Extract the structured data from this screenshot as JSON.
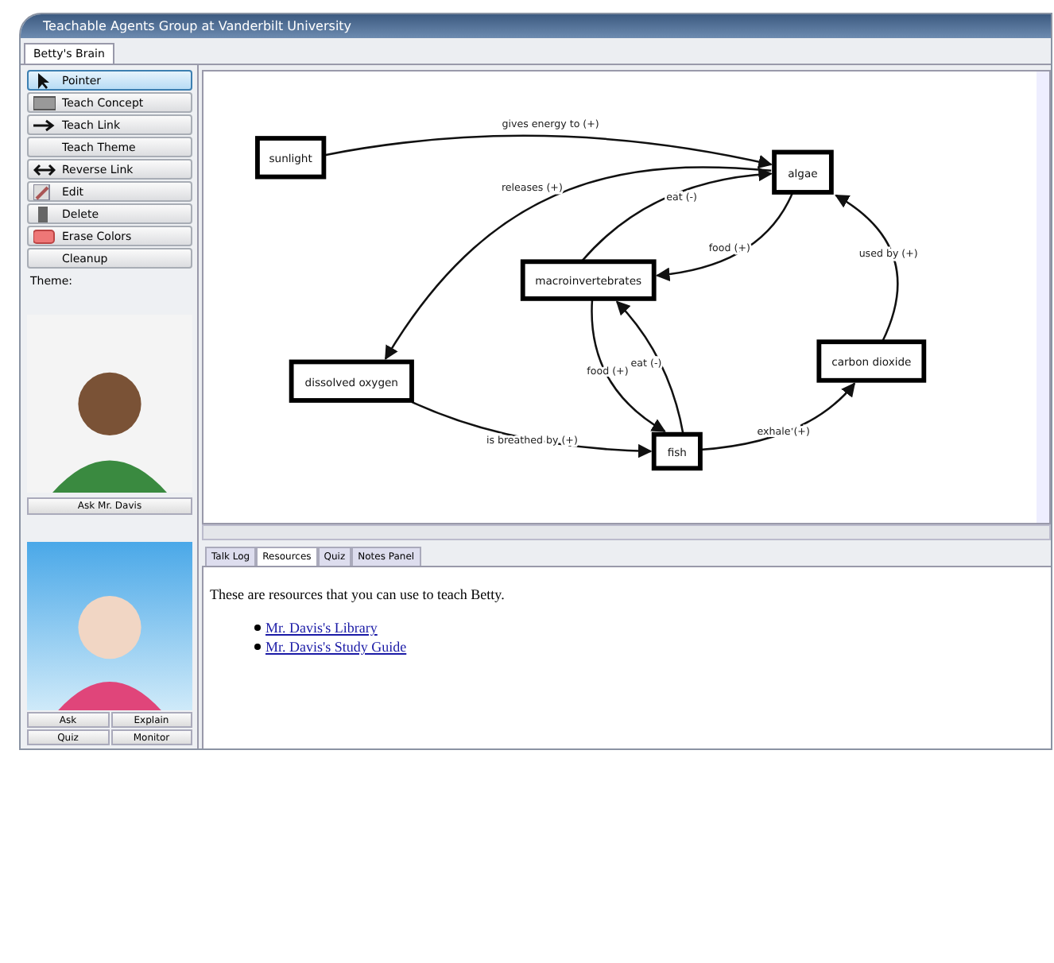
{
  "window": {
    "title": "Teachable Agents Group at Vanderbilt University"
  },
  "tabs": [
    {
      "label": "Betty's Brain",
      "selected": true
    }
  ],
  "tools": [
    {
      "label": "Pointer",
      "selected": true
    },
    {
      "label": "Teach Concept",
      "selected": false
    },
    {
      "label": "Teach Link",
      "selected": false
    },
    {
      "label": "Teach Theme",
      "selected": false
    },
    {
      "label": "Reverse Link",
      "selected": false
    },
    {
      "label": "Edit",
      "selected": false
    },
    {
      "label": "Delete",
      "selected": false
    },
    {
      "label": "Erase Colors",
      "selected": false
    },
    {
      "label": "Cleanup",
      "selected": false
    }
  ],
  "theme_label": "Theme:",
  "mentor": {
    "button": "Ask Mr. Davis"
  },
  "agent": {
    "buttons": [
      "Ask",
      "Explain",
      "Quiz",
      "Monitor"
    ]
  },
  "concept_map": {
    "nodes": [
      {
        "label": "sunlight"
      },
      {
        "label": "algae"
      },
      {
        "label": "macroinvertebrates"
      },
      {
        "label": "dissolved oxygen"
      },
      {
        "label": "fish"
      },
      {
        "label": "carbon dioxide"
      }
    ],
    "links": [
      {
        "label": "gives energy to (+)"
      },
      {
        "label": "releases (+)"
      },
      {
        "label": "eat (-)"
      },
      {
        "label": "food (+)"
      },
      {
        "label": "food (+)"
      },
      {
        "label": "eat (-)"
      },
      {
        "label": "is breathed by (+)"
      },
      {
        "label": "exhale (+)"
      },
      {
        "label": "used by (+)"
      }
    ]
  },
  "bottom_tabs": [
    {
      "label": "Talk Log",
      "selected": false
    },
    {
      "label": "Resources",
      "selected": true
    },
    {
      "label": "Quiz",
      "selected": false
    },
    {
      "label": "Notes Panel",
      "selected": false
    }
  ],
  "resources": {
    "intro": "These are resources that you can use to teach Betty.",
    "links": [
      "Mr. Davis's Library",
      "Mr. Davis's Study Guide"
    ]
  }
}
